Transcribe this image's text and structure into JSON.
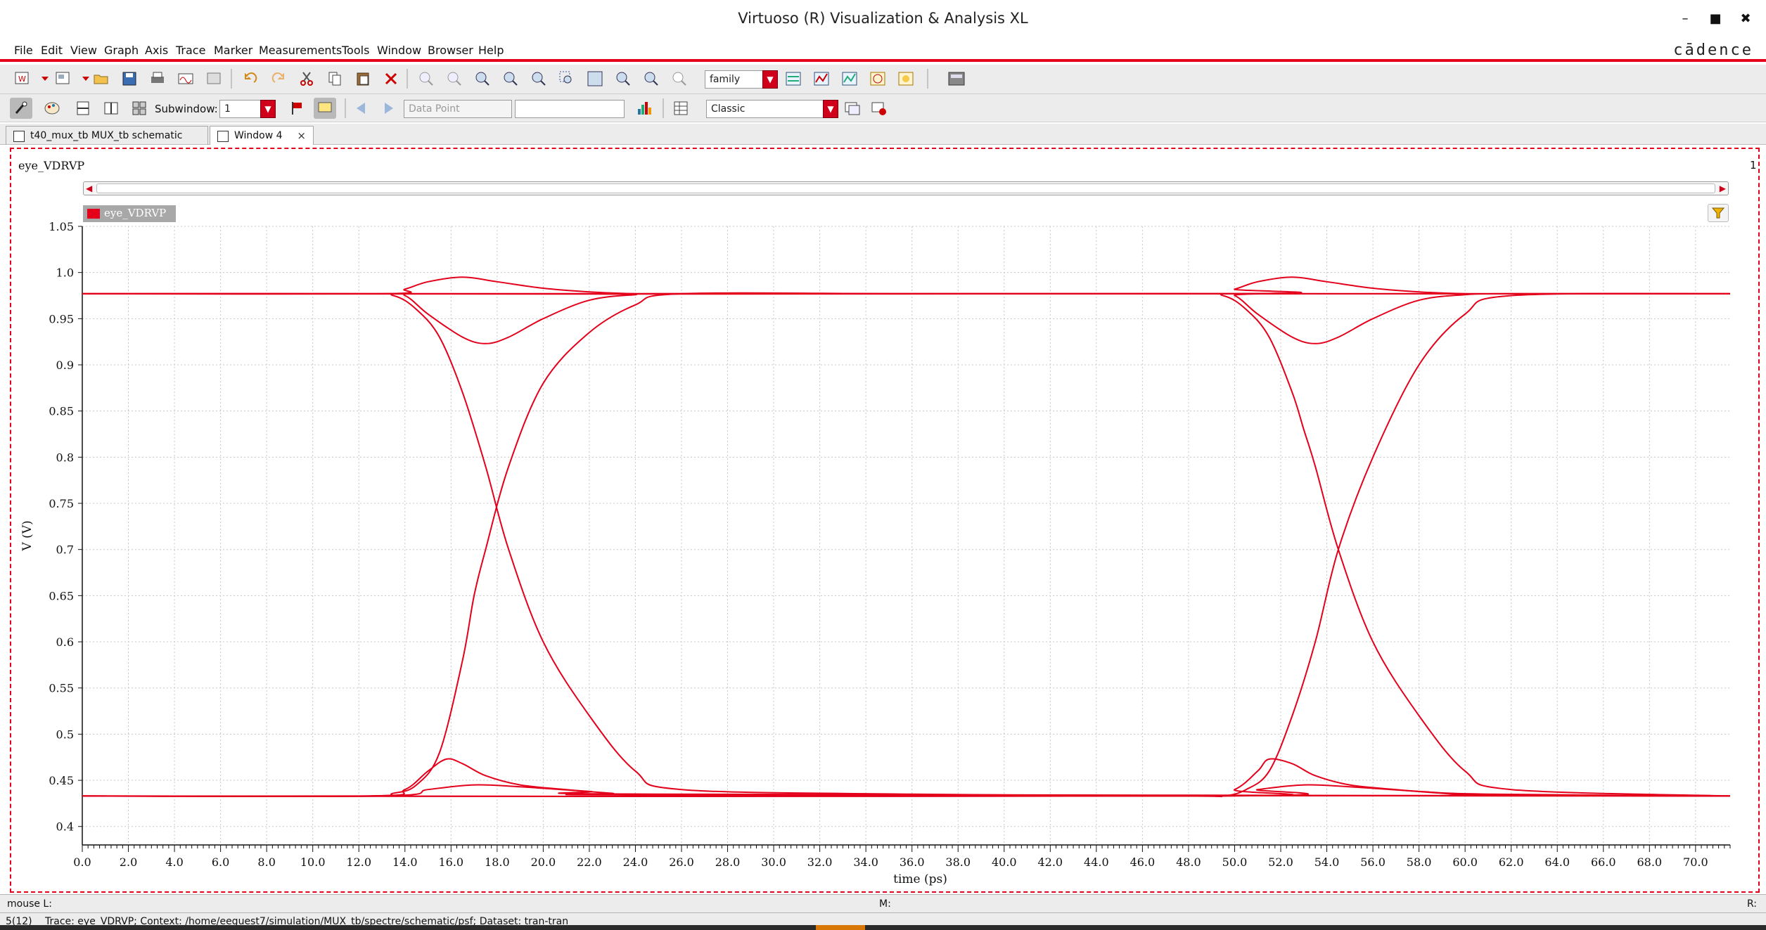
{
  "window": {
    "title": "Virtuoso (R) Visualization & Analysis XL",
    "brand": "cādence"
  },
  "menu": [
    "File",
    "Edit",
    "View",
    "Graph",
    "Axis",
    "Trace",
    "Marker",
    "Measurements",
    "Tools",
    "Window",
    "Browser",
    "Help"
  ],
  "toolbar": {
    "family_value": "family",
    "subwindow_label": "Subwindow:",
    "subwindow_value": "1",
    "datapoint_placeholder": "Data Point",
    "style_value": "Classic"
  },
  "tabs": [
    {
      "label": "t40_mux_tb MUX_tb schematic",
      "active": false
    },
    {
      "label": "Window 4",
      "active": true,
      "close": "×"
    }
  ],
  "plot": {
    "title": "eye_VDRVP",
    "subwindow_index": "1",
    "legend": "eye_VDRVP"
  },
  "status": {
    "mouse_label": "mouse L:",
    "middle_label": "M:",
    "right_label": "R:",
    "page_count": "5(12)",
    "trace_info": "Trace: eye_VDRVP; Context: /home/eeguest7/simulation/MUX_tb/spectre/schematic/psf; Dataset: tran-tran"
  },
  "chart_data": {
    "type": "line",
    "title": "eye_VDRVP",
    "xlabel": "time (ps)",
    "ylabel": "V (V)",
    "xlim": [
      0,
      71.5
    ],
    "ylim": [
      0.38,
      1.05
    ],
    "xticks": [
      0,
      2,
      4,
      6,
      8,
      10,
      12,
      14,
      16,
      18,
      20,
      22,
      24,
      26,
      28,
      30,
      32,
      34,
      36,
      38,
      40,
      42,
      44,
      46,
      48,
      50,
      52,
      54,
      56,
      58,
      60,
      62,
      64,
      66,
      68,
      70
    ],
    "yticks": [
      0.4,
      0.45,
      0.5,
      0.55,
      0.6,
      0.65,
      0.7,
      0.75,
      0.8,
      0.85,
      0.9,
      0.95,
      1.0,
      1.05
    ],
    "grid": true,
    "line_color": "#e4001b",
    "series": [
      {
        "name": "eye_VDRVP",
        "x": [
          0,
          12,
          13.5,
          14.5,
          15.5,
          16.5,
          17.5,
          18.5,
          20,
          22,
          24,
          26,
          36,
          48,
          49.5,
          50.5,
          51.5,
          52.5,
          53.5,
          54.5,
          56,
          58,
          60,
          62,
          71.5
        ],
        "y": [
          0.977,
          0.977,
          0.975,
          0.96,
          0.93,
          0.87,
          0.79,
          0.7,
          0.6,
          0.52,
          0.46,
          0.44,
          0.435,
          0.433,
          0.433,
          0.44,
          0.46,
          0.52,
          0.6,
          0.7,
          0.8,
          0.9,
          0.955,
          0.975,
          0.977
        ]
      },
      {
        "name": "eye_VDRVP",
        "x": [
          0,
          12,
          13.5,
          14.5,
          15.5,
          16.5,
          17,
          17.5,
          18.5,
          20,
          22,
          24,
          26,
          36,
          48,
          49.5,
          50.5,
          51.5,
          52.5,
          53,
          53.5,
          54.5,
          56,
          58,
          60,
          62,
          71.5
        ],
        "y": [
          0.433,
          0.433,
          0.436,
          0.445,
          0.48,
          0.58,
          0.65,
          0.7,
          0.79,
          0.88,
          0.935,
          0.965,
          0.977,
          0.977,
          0.977,
          0.975,
          0.96,
          0.93,
          0.87,
          0.83,
          0.79,
          0.7,
          0.6,
          0.52,
          0.46,
          0.44,
          0.433
        ]
      },
      {
        "name": "eye_VDRVP",
        "x": [
          0,
          13,
          14,
          15,
          16.5,
          17.5,
          18.5,
          20,
          22,
          24,
          26,
          71.5
        ],
        "y": [
          0.977,
          0.977,
          0.975,
          0.955,
          0.93,
          0.923,
          0.93,
          0.95,
          0.97,
          0.976,
          0.977,
          0.977
        ]
      },
      {
        "name": "eye_VDRVP",
        "x": [
          0,
          13,
          14,
          15,
          16.5,
          18,
          20,
          22,
          24,
          26,
          71.5
        ],
        "y": [
          0.977,
          0.977,
          0.982,
          0.99,
          0.995,
          0.99,
          0.983,
          0.979,
          0.977,
          0.977,
          0.977
        ]
      },
      {
        "name": "eye_VDRVP",
        "x": [
          0,
          49,
          50,
          51,
          52.5,
          53.5,
          54.5,
          56,
          58,
          60,
          62,
          71.5
        ],
        "y": [
          0.977,
          0.977,
          0.975,
          0.955,
          0.93,
          0.923,
          0.93,
          0.95,
          0.97,
          0.976,
          0.977,
          0.977
        ]
      },
      {
        "name": "eye_VDRVP",
        "x": [
          0,
          49,
          50,
          51,
          52.5,
          54,
          56,
          58,
          60,
          62,
          71.5
        ],
        "y": [
          0.977,
          0.977,
          0.982,
          0.99,
          0.995,
          0.99,
          0.983,
          0.979,
          0.977,
          0.977,
          0.977
        ]
      },
      {
        "name": "eye_VDRVP",
        "x": [
          0,
          12.5,
          14,
          15,
          15.8,
          16.5,
          17.5,
          19,
          21,
          23,
          25,
          71.5
        ],
        "y": [
          0.433,
          0.433,
          0.44,
          0.46,
          0.473,
          0.468,
          0.455,
          0.445,
          0.44,
          0.436,
          0.434,
          0.433
        ]
      },
      {
        "name": "eye_VDRVP",
        "x": [
          0,
          13,
          15,
          17,
          19,
          22,
          25,
          71.5
        ],
        "y": [
          0.433,
          0.433,
          0.44,
          0.445,
          0.443,
          0.438,
          0.435,
          0.433
        ]
      },
      {
        "name": "eye_VDRVP",
        "x": [
          0,
          48.5,
          50,
          51,
          51.5,
          52.5,
          53.5,
          55,
          57,
          59,
          61,
          71.5
        ],
        "y": [
          0.433,
          0.433,
          0.44,
          0.46,
          0.473,
          0.468,
          0.455,
          0.445,
          0.44,
          0.436,
          0.434,
          0.433
        ]
      },
      {
        "name": "eye_VDRVP",
        "x": [
          0,
          49,
          51,
          53,
          55,
          58,
          61,
          71.5
        ],
        "y": [
          0.433,
          0.433,
          0.44,
          0.445,
          0.443,
          0.438,
          0.435,
          0.433
        ]
      }
    ]
  }
}
